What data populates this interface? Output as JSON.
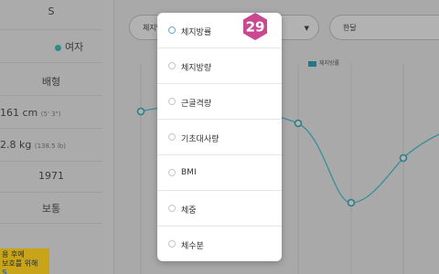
{
  "sidebar": {
    "top_label": "S",
    "gender": "여자",
    "blood_type": "배형",
    "height": "161 cm",
    "height_alt": "(5' 3\")",
    "weight": "2.8 kg",
    "weight_alt": "(138.5 lb)",
    "birth_year": "1971",
    "body_type": "보통"
  },
  "notice": {
    "line1": "용 후에",
    "line2": "보호를 위해",
    "line3": "S"
  },
  "filters": {
    "metric_select": "체지방률",
    "period_select": "한달"
  },
  "legend": {
    "label": "체지방률"
  },
  "dropdown": {
    "badge": "29",
    "options": [
      "체지방률",
      "체지방량",
      "근골격량",
      "기초대사량",
      "BMI",
      "체중",
      "체수분"
    ],
    "selected_index": 0
  },
  "colors": {
    "accent": "#2f8b8b",
    "badge": "#c9488f",
    "line": "#3a8e9a"
  }
}
